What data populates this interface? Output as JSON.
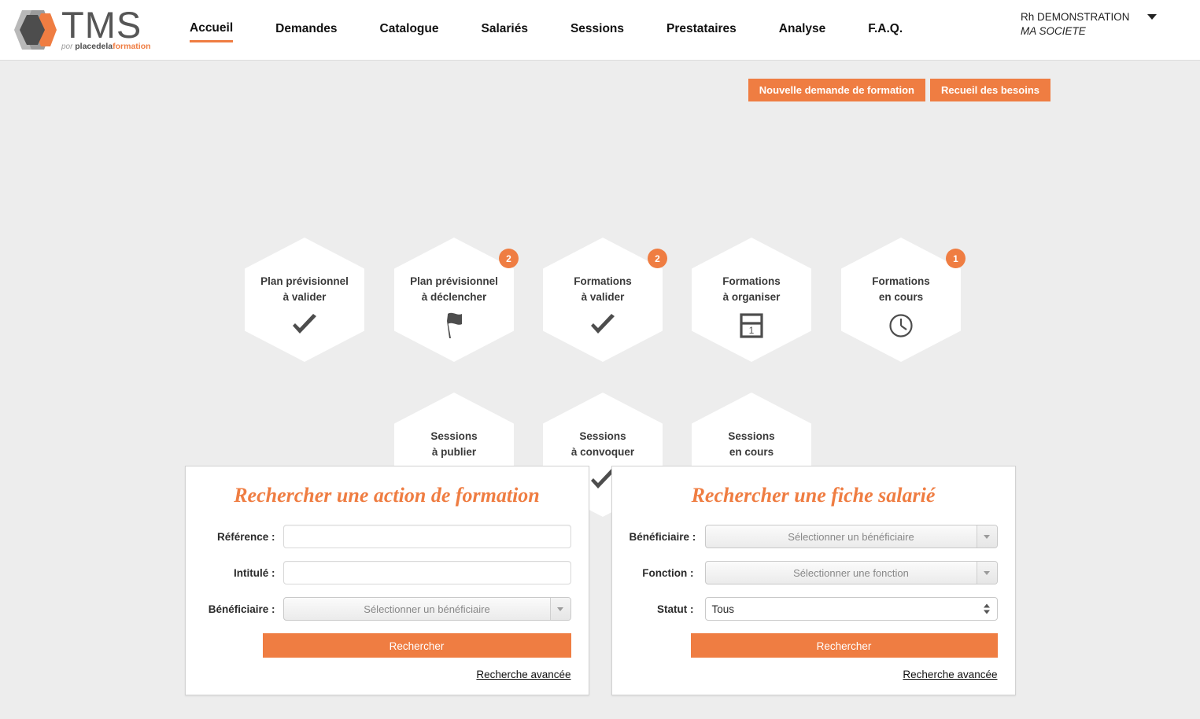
{
  "brand": {
    "name": "TMS",
    "tagline_italic": "por ",
    "tagline_bold": "placedela",
    "tagline_accent": "formation",
    "accent_color": "#ef7d42"
  },
  "nav": {
    "items": [
      {
        "label": "Accueil",
        "active": true
      },
      {
        "label": "Demandes",
        "active": false
      },
      {
        "label": "Catalogue",
        "active": false
      },
      {
        "label": "Salariés",
        "active": false
      },
      {
        "label": "Sessions",
        "active": false
      },
      {
        "label": "Prestataires",
        "active": false
      },
      {
        "label": "Analyse",
        "active": false
      },
      {
        "label": "F.A.Q.",
        "active": false
      }
    ]
  },
  "user": {
    "name": "Rh DEMONSTRATION",
    "company": "MA SOCIETE",
    "caret_icon": "chevron-down-icon"
  },
  "top_actions": {
    "new_request": "Nouvelle demande de formation",
    "needs_collection": "Recueil des besoins"
  },
  "tiles": [
    {
      "label": "Plan prévisionnel\nà valider",
      "icon": "check-icon",
      "badge": null,
      "row": 1,
      "col": 1
    },
    {
      "label": "Plan prévisionnel\nà déclencher",
      "icon": "flag-icon",
      "badge": "2",
      "row": 1,
      "col": 2
    },
    {
      "label": "Formations\nà valider",
      "icon": "check-icon",
      "badge": "2",
      "row": 1,
      "col": 3
    },
    {
      "label": "Formations\nà organiser",
      "icon": "calendar-icon",
      "badge": null,
      "row": 1,
      "col": 4
    },
    {
      "label": "Formations\nen cours",
      "icon": "clock-icon",
      "badge": "1",
      "row": 1,
      "col": 5
    },
    {
      "label": "Sessions\nà publier",
      "icon": "flag-icon",
      "badge": null,
      "row": 2,
      "col": 2
    },
    {
      "label": "Sessions\nà convoquer",
      "icon": "check-icon",
      "badge": null,
      "row": 2,
      "col": 3
    },
    {
      "label": "Sessions\nen cours",
      "icon": "calendar-icon",
      "badge": null,
      "row": 2,
      "col": 4
    }
  ],
  "calendar_icon_day": "1",
  "search_training": {
    "title": "Rechercher une action de formation",
    "reference_label": "Référence :",
    "reference_value": "",
    "title_label": "Intitulé :",
    "title_value": "",
    "beneficiary_label": "Bénéficiaire :",
    "beneficiary_value": "Sélectionner un bénéficiaire",
    "submit_label": "Rechercher",
    "advanced_label": "Recherche avancée"
  },
  "search_employee": {
    "title": "Rechercher une fiche salarié",
    "beneficiary_label": "Bénéficiaire :",
    "beneficiary_value": "Sélectionner un bénéficiaire",
    "function_label": "Fonction :",
    "function_value": "Sélectionner une fonction",
    "status_label": "Statut :",
    "status_value": "Tous",
    "submit_label": "Rechercher",
    "advanced_label": "Recherche avancée"
  }
}
